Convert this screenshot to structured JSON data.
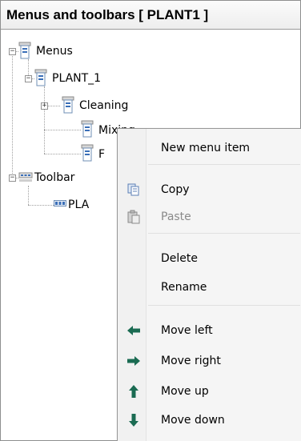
{
  "window": {
    "title": "Menus and toolbars [ PLANT1 ]"
  },
  "tree": {
    "menus": {
      "label": "Menus",
      "toggle": "−"
    },
    "plant_1": {
      "label": "PLANT_1",
      "toggle": "−"
    },
    "cleaning": {
      "label": "Cleaning",
      "toggle": "+"
    },
    "mixing": {
      "label": "Mixing"
    },
    "f_item": {
      "label": "F"
    },
    "toolbars": {
      "label": "Toolbar",
      "toggle": "−"
    },
    "pla": {
      "label": "PLA"
    }
  },
  "context_menu": {
    "new_menu_item": "New menu item",
    "copy": "Copy",
    "paste": "Paste",
    "delete": "Delete",
    "rename": "Rename",
    "move_left": "Move left",
    "move_right": "Move right",
    "move_up": "Move up",
    "move_down": "Move down"
  },
  "colors": {
    "arrow_green": "#1a6b52",
    "menu_icon_blue": "#3a6fb8",
    "disabled_text": "#8a8a8a"
  }
}
